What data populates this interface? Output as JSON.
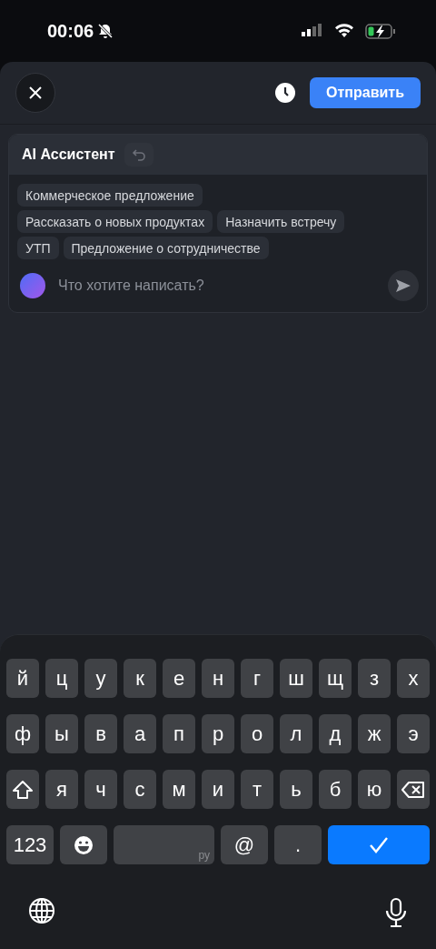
{
  "status_bar": {
    "time": "00:06"
  },
  "header": {
    "send_label": "Отправить"
  },
  "assistant": {
    "title": "AI Ассистент",
    "suggestions": [
      [
        "Коммерческое предложение"
      ],
      [
        "Рассказать о новых продуктах",
        "Назначить встречу"
      ],
      [
        "УТП",
        "Предложение о сотрудничестве"
      ]
    ],
    "input": {
      "placeholder": "Что хотите написать?"
    }
  },
  "keyboard": {
    "rows": [
      [
        {
          "kind": "letter",
          "label": "й"
        },
        {
          "kind": "letter",
          "label": "ц"
        },
        {
          "kind": "letter",
          "label": "у"
        },
        {
          "kind": "letter",
          "label": "к"
        },
        {
          "kind": "letter",
          "label": "е"
        },
        {
          "kind": "letter",
          "label": "н"
        },
        {
          "kind": "letter",
          "label": "г"
        },
        {
          "kind": "letter",
          "label": "ш"
        },
        {
          "kind": "letter",
          "label": "щ"
        },
        {
          "kind": "letter",
          "label": "з"
        },
        {
          "kind": "letter",
          "label": "х"
        }
      ],
      [
        {
          "kind": "letter",
          "label": "ф"
        },
        {
          "kind": "letter",
          "label": "ы"
        },
        {
          "kind": "letter",
          "label": "в"
        },
        {
          "kind": "letter",
          "label": "а"
        },
        {
          "kind": "letter",
          "label": "п"
        },
        {
          "kind": "letter",
          "label": "р"
        },
        {
          "kind": "letter",
          "label": "о"
        },
        {
          "kind": "letter",
          "label": "л"
        },
        {
          "kind": "letter",
          "label": "д"
        },
        {
          "kind": "letter",
          "label": "ж"
        },
        {
          "kind": "letter",
          "label": "э"
        }
      ],
      [
        {
          "kind": "shift"
        },
        {
          "kind": "letter",
          "label": "я"
        },
        {
          "kind": "letter",
          "label": "ч"
        },
        {
          "kind": "letter",
          "label": "с"
        },
        {
          "kind": "letter",
          "label": "м"
        },
        {
          "kind": "letter",
          "label": "и"
        },
        {
          "kind": "letter",
          "label": "т"
        },
        {
          "kind": "letter",
          "label": "ь"
        },
        {
          "kind": "letter",
          "label": "б"
        },
        {
          "kind": "letter",
          "label": "ю"
        },
        {
          "kind": "backspace"
        }
      ]
    ],
    "bottom_keys": [
      {
        "kind": "numbers",
        "label": "123"
      },
      {
        "kind": "emoji"
      },
      {
        "kind": "space",
        "label": "ру"
      },
      {
        "kind": "symbol",
        "label": "@"
      },
      {
        "kind": "symbol",
        "label": "."
      },
      {
        "kind": "return"
      }
    ]
  }
}
